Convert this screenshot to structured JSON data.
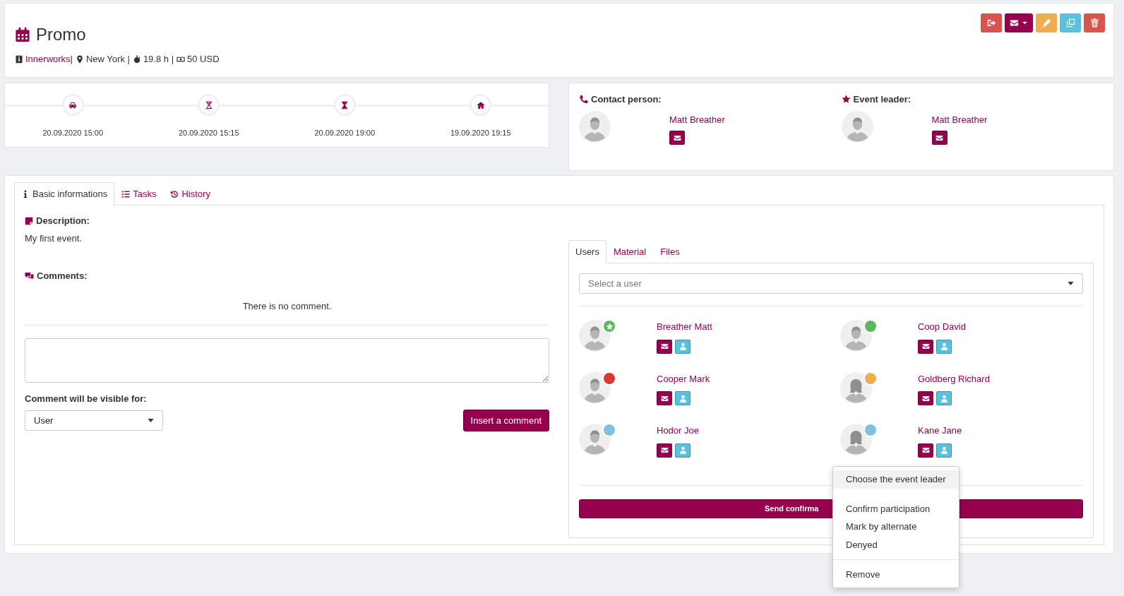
{
  "header": {
    "title": "Promo",
    "meta": [
      {
        "kind": "client",
        "text": "Innerworks"
      },
      {
        "kind": "separator",
        "text": "|"
      },
      {
        "kind": "location",
        "text": "New York |"
      },
      {
        "kind": "duration",
        "text": "19.8 h |"
      },
      {
        "kind": "budget",
        "text": "50 USD"
      }
    ],
    "actions": [
      {
        "kind": "logout"
      },
      {
        "kind": "mail-dropdown"
      },
      {
        "kind": "edit"
      },
      {
        "kind": "copy"
      },
      {
        "kind": "delete"
      }
    ]
  },
  "timeline": [
    {
      "kind": "car",
      "date": "20.09.2020 15:00"
    },
    {
      "kind": "hourglass-start",
      "date": "20.09.2020 15:15"
    },
    {
      "kind": "hourglass-half",
      "date": "20.09.2020 19:00"
    },
    {
      "kind": "home",
      "date": "19.09.2020 19:15"
    }
  ],
  "contacts": [
    {
      "kind": "phone",
      "label": "Contact person:",
      "name": "Matt Breather"
    },
    {
      "kind": "star",
      "label": "Event leader:",
      "name": "Matt Breather"
    }
  ],
  "tabs": [
    {
      "kind": "info",
      "label": "Basic informations",
      "selected": true
    },
    {
      "kind": "tasks",
      "label": "Tasks",
      "selected": false
    },
    {
      "kind": "history",
      "label": "History",
      "selected": false
    }
  ],
  "basic": {
    "description_label": "Description:",
    "description": "My first event.",
    "comments_label": "Comments:",
    "empty_comments": "There is no comment.",
    "visibility_label": "Comment will be visible for:",
    "visibility_value": "User",
    "insert_button": "Insert a comment"
  },
  "users_panel": {
    "tabs": [
      {
        "label": "Users",
        "selected": true
      },
      {
        "label": "Material",
        "selected": false
      },
      {
        "label": "Files",
        "selected": false
      }
    ],
    "select_placeholder": "Select a user",
    "list": [
      {
        "name": "Breather Matt",
        "kind": "male",
        "color": "#5cb85c",
        "leader": true
      },
      {
        "name": "Coop David",
        "kind": "male",
        "color": "#5cb85c",
        "leader": false
      },
      {
        "name": "Cooper Mark",
        "kind": "male",
        "color": "#d9372f",
        "leader": false
      },
      {
        "name": "Goldberg Richard",
        "kind": "female",
        "color": "#f0ad4e",
        "leader": false
      },
      {
        "name": "Hodor Joe",
        "kind": "male",
        "color": "#83bfe0",
        "leader": false
      },
      {
        "name": "Kane Jane",
        "kind": "female",
        "color": "#83bfe0",
        "leader": false
      }
    ],
    "send_button": "Send confirma"
  },
  "context_menu": [
    {
      "kind": "item",
      "label": "Choose the event leader",
      "selected": true
    },
    {
      "kind": "spacer"
    },
    {
      "kind": "item",
      "label": "Confirm participation",
      "selected": false
    },
    {
      "kind": "item",
      "label": "Mark by alternate",
      "selected": false
    },
    {
      "kind": "item",
      "label": "Denyed",
      "selected": false
    },
    {
      "kind": "divider"
    },
    {
      "kind": "item",
      "label": "Remove",
      "selected": false
    }
  ]
}
